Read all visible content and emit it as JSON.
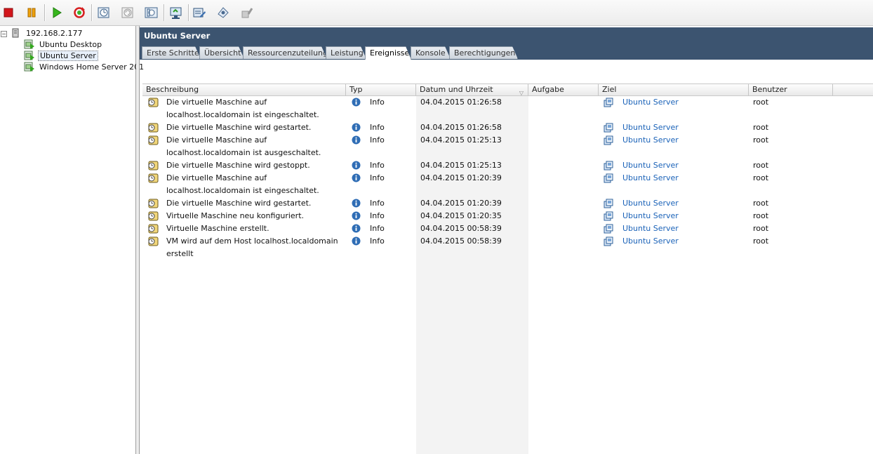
{
  "toolbar": {
    "buttons": [
      {
        "name": "stop-icon"
      },
      {
        "name": "pause-icon"
      },
      {
        "name": "play-icon"
      },
      {
        "name": "reset-icon"
      },
      {
        "name": "snapshot-icon"
      },
      {
        "name": "revert-snapshot-icon"
      },
      {
        "name": "snapshot-manager-icon"
      },
      {
        "name": "console-icon"
      },
      {
        "name": "edit-settings-icon"
      },
      {
        "name": "tools-icon"
      },
      {
        "name": "permissions-icon"
      }
    ]
  },
  "tree": {
    "host": "192.168.2.177",
    "vms": [
      "Ubuntu Desktop",
      "Ubuntu Server",
      "Windows Home Server 201"
    ],
    "selected": "Ubuntu Server"
  },
  "header": {
    "title": "Ubuntu Server",
    "tabs": [
      "Erste Schritte",
      "Übersicht",
      "Ressourcenzuteilung",
      "Leistung",
      "Ereignisse",
      "Konsole",
      "Berechtigungen"
    ],
    "active_tab": "Ereignisse"
  },
  "table": {
    "columns": [
      "Beschreibung",
      "Typ",
      "Datum und Uhrzeit",
      "Aufgabe",
      "Ziel",
      "Benutzer"
    ],
    "rows": [
      {
        "description": "Die virtuelle Maschine auf localhost.localdomain ist eingeschaltet.",
        "type": "Info",
        "datetime": "04.04.2015 01:26:58",
        "task": "",
        "target": "Ubuntu Server",
        "user": "root"
      },
      {
        "description": "Die virtuelle Maschine wird gestartet.",
        "type": "Info",
        "datetime": "04.04.2015 01:26:58",
        "task": "",
        "target": "Ubuntu Server",
        "user": "root"
      },
      {
        "description": "Die virtuelle Maschine auf localhost.localdomain ist ausgeschaltet.",
        "type": "Info",
        "datetime": "04.04.2015 01:25:13",
        "task": "",
        "target": "Ubuntu Server",
        "user": "root"
      },
      {
        "description": "Die virtuelle Maschine wird gestoppt.",
        "type": "Info",
        "datetime": "04.04.2015 01:25:13",
        "task": "",
        "target": "Ubuntu Server",
        "user": "root"
      },
      {
        "description": "Die virtuelle Maschine auf localhost.localdomain ist eingeschaltet.",
        "type": "Info",
        "datetime": "04.04.2015 01:20:39",
        "task": "",
        "target": "Ubuntu Server",
        "user": "root"
      },
      {
        "description": "Die virtuelle Maschine wird gestartet.",
        "type": "Info",
        "datetime": "04.04.2015 01:20:39",
        "task": "",
        "target": "Ubuntu Server",
        "user": "root"
      },
      {
        "description": "Virtuelle Maschine neu konfiguriert.",
        "type": "Info",
        "datetime": "04.04.2015 01:20:35",
        "task": "",
        "target": "Ubuntu Server",
        "user": "root"
      },
      {
        "description": "Virtuelle Maschine erstellt.",
        "type": "Info",
        "datetime": "04.04.2015 00:58:39",
        "task": "",
        "target": "Ubuntu Server",
        "user": "root"
      },
      {
        "description": "VM wird auf dem Host localhost.localdomain erstellt",
        "type": "Info",
        "datetime": "04.04.2015 00:58:39",
        "task": "",
        "target": "Ubuntu Server",
        "user": "root"
      }
    ]
  },
  "colors": {
    "header_bg": "#3c5470",
    "link": "#1a62b8",
    "info_icon": "#2f6db5"
  }
}
